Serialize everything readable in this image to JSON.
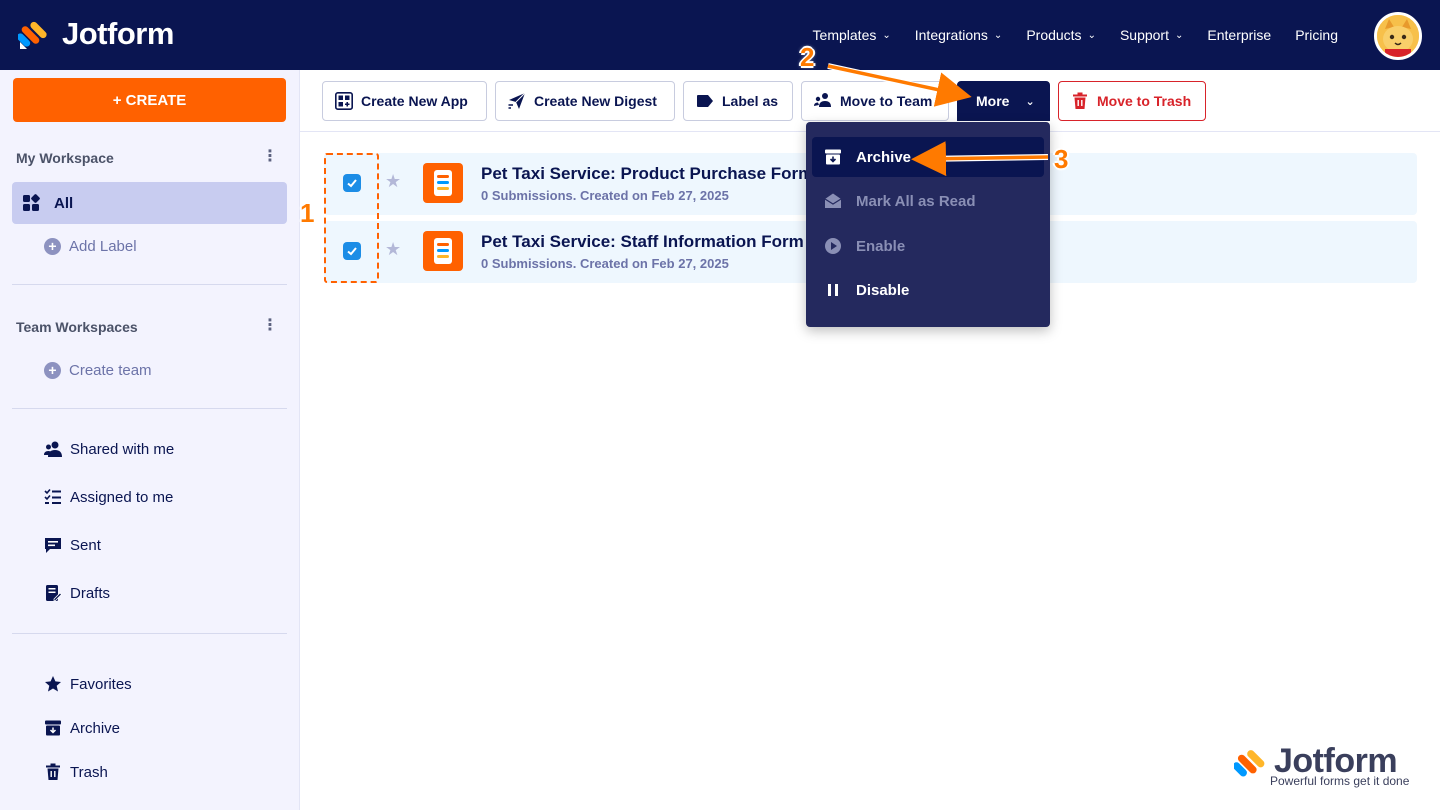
{
  "header": {
    "brand": "Jotform",
    "nav": [
      {
        "label": "Templates",
        "chevron": true
      },
      {
        "label": "Integrations",
        "chevron": true
      },
      {
        "label": "Products",
        "chevron": true
      },
      {
        "label": "Support",
        "chevron": true
      },
      {
        "label": "Enterprise",
        "chevron": false
      },
      {
        "label": "Pricing",
        "chevron": false
      }
    ]
  },
  "sidebar": {
    "create_label": "+ CREATE",
    "my_workspace_title": "My Workspace",
    "all_label": "All",
    "add_label": "Add Label",
    "team_workspaces_title": "Team Workspaces",
    "create_team_label": "Create team",
    "shared_label": "Shared with me",
    "assigned_label": "Assigned to me",
    "sent_label": "Sent",
    "drafts_label": "Drafts",
    "favorites_label": "Favorites",
    "archive_label": "Archive",
    "trash_label": "Trash"
  },
  "toolbar": {
    "create_app": "Create New App",
    "create_digest": "Create New Digest",
    "label_as": "Label as",
    "move_to_team": "Move to Team",
    "more": "More",
    "move_to_trash": "Move to Trash"
  },
  "forms": [
    {
      "title": "Pet Taxi Service: Product Purchase Form",
      "subtitle": "0 Submissions. Created on Feb 27, 2025",
      "checked": true
    },
    {
      "title": "Pet Taxi Service: Staff Information Form",
      "subtitle": "0 Submissions. Created on Feb 27, 2025",
      "checked": true
    }
  ],
  "dropdown": {
    "archive": "Archive",
    "mark_all_read": "Mark All as Read",
    "enable": "Enable",
    "disable": "Disable"
  },
  "annotations": {
    "one": "1",
    "two": "2",
    "three": "3"
  },
  "watermark": {
    "brand": "Jotform",
    "tagline": "Powerful forms get it done"
  },
  "colors": {
    "navy": "#0a1551",
    "orange": "#ff6100",
    "accent_blue": "#1c8de6",
    "danger": "#d8232a"
  }
}
